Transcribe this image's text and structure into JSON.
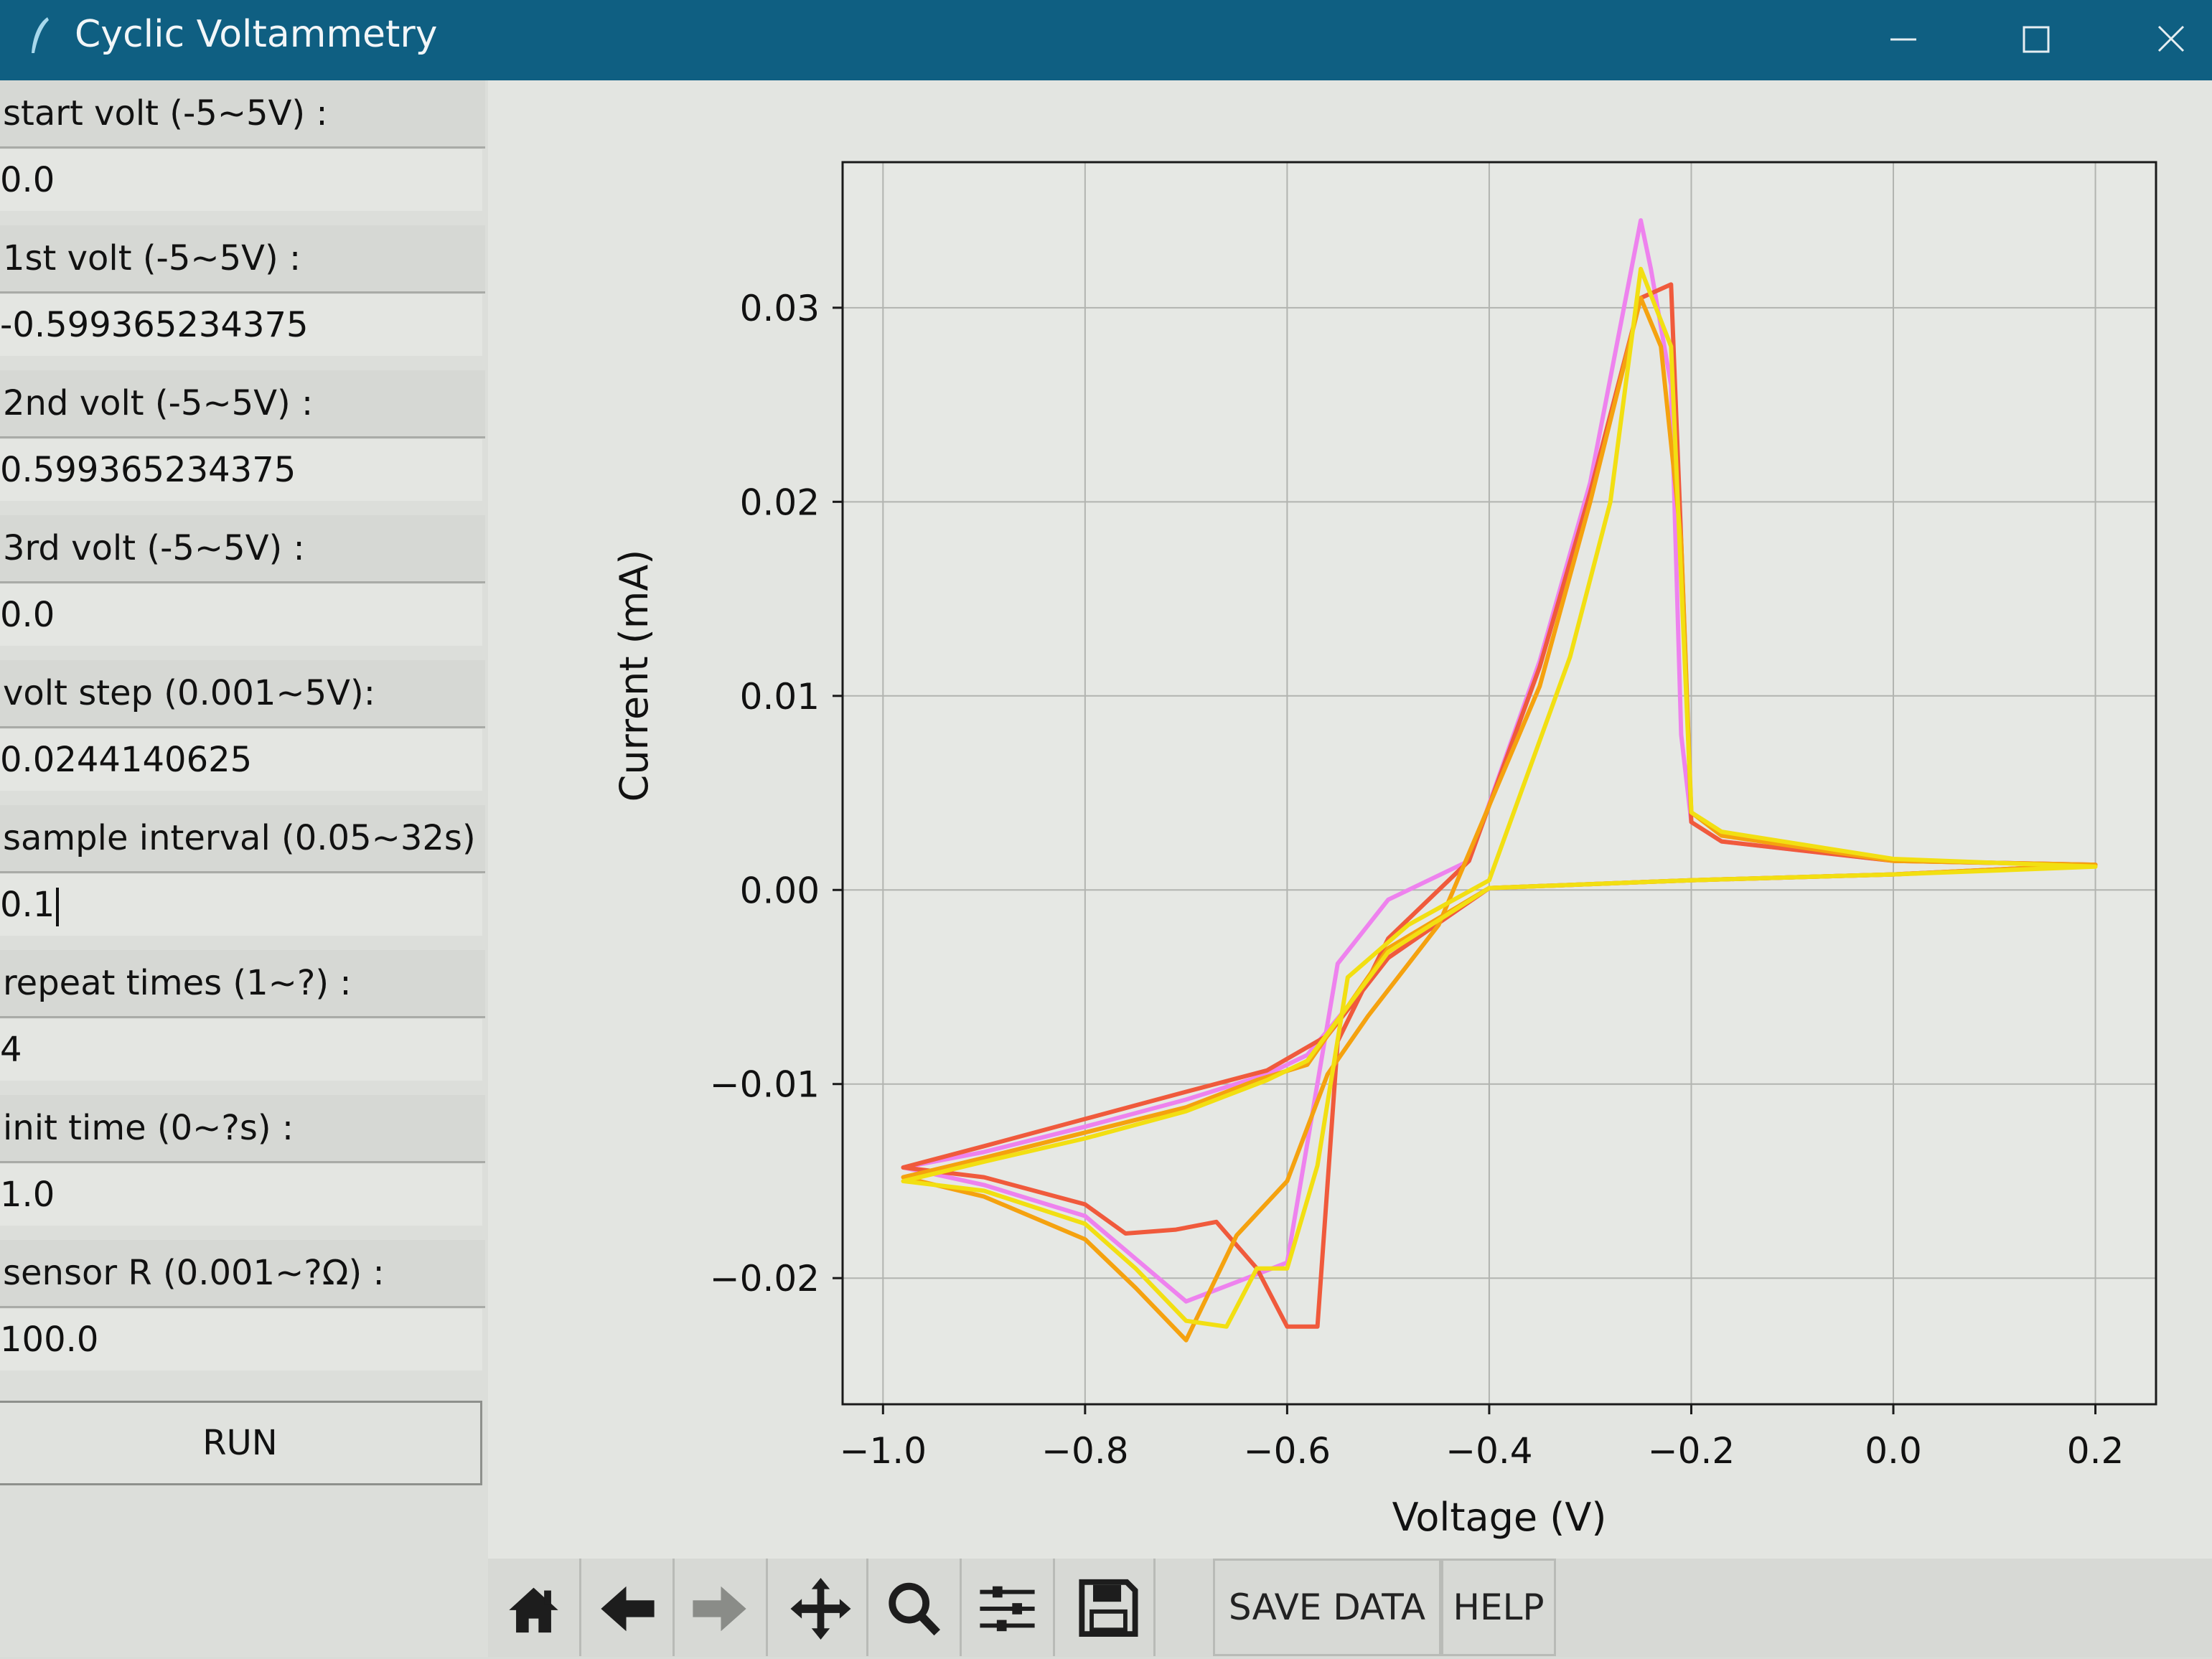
{
  "window": {
    "title": "Cyclic Voltammetry"
  },
  "fields": [
    {
      "label": "start volt (-5~5V) :",
      "value": "0.0"
    },
    {
      "label": "1st volt (-5~5V) :",
      "value": "-0.599365234375"
    },
    {
      "label": "2nd volt (-5~5V) :",
      "value": "0.599365234375"
    },
    {
      "label": "3rd volt (-5~5V) :",
      "value": "0.0"
    },
    {
      "label": "volt step (0.001~5V):",
      "value": "0.0244140625"
    },
    {
      "label": "sample interval (0.05~32s) :",
      "value": "0.1"
    },
    {
      "label": "repeat times (1~?) :",
      "value": "4"
    },
    {
      "label": "init time (0~?s) :",
      "value": "1.0"
    },
    {
      "label": "sensor R (0.001~?Ω) :",
      "value": "100.0"
    }
  ],
  "run_label": "RUN",
  "toolbar": {
    "icons": [
      "home-icon",
      "back-arrow-icon",
      "forward-arrow-icon",
      "pan-icon",
      "zoom-icon",
      "configure-subplots-icon",
      "save-icon"
    ],
    "save_data_label": "SAVE DATA",
    "help_label": "HELP"
  },
  "chart_data": {
    "type": "line",
    "title": "",
    "xlabel": "Voltage (V)",
    "ylabel": "Current (mA)",
    "xlim": [
      -1.04,
      0.26
    ],
    "ylim": [
      -0.0265,
      0.0375
    ],
    "xticks": [
      -1.0,
      -0.8,
      -0.6,
      -0.4,
      -0.2,
      0.0,
      0.2
    ],
    "xtick_labels": [
      "−1.0",
      "−0.8",
      "−0.6",
      "−0.4",
      "−0.2",
      "0.0",
      "0.2"
    ],
    "yticks": [
      -0.02,
      -0.01,
      0.0,
      0.01,
      0.02,
      0.03
    ],
    "ytick_labels": [
      "−0.02",
      "−0.01",
      "0.00",
      "0.01",
      "0.02",
      "0.03"
    ],
    "grid": true,
    "series": [
      {
        "color": "#ee82ee",
        "x": [
          0.2,
          0.0,
          -0.2,
          -0.4,
          -0.5,
          -0.58,
          -0.62,
          -0.7,
          -0.8,
          -0.9,
          -0.98,
          -0.9,
          -0.8,
          -0.7,
          -0.6,
          -0.55,
          -0.5,
          -0.42,
          -0.35,
          -0.3,
          -0.25,
          -0.24,
          -0.22,
          -0.21,
          -0.2,
          -0.17,
          0.0,
          0.2
        ],
        "y": [
          0.0013,
          0.0008,
          0.0005,
          0.0001,
          -0.0035,
          -0.0085,
          -0.0095,
          -0.0108,
          -0.0122,
          -0.0135,
          -0.0143,
          -0.0152,
          -0.0168,
          -0.0212,
          -0.0192,
          -0.0038,
          -0.0005,
          0.0015,
          0.0118,
          0.021,
          0.0345,
          0.032,
          0.026,
          0.008,
          0.0035,
          0.0025,
          0.0015,
          0.0013
        ]
      },
      {
        "color": "#f05a3c",
        "x": [
          0.2,
          0.0,
          -0.2,
          -0.4,
          -0.5,
          -0.56,
          -0.62,
          -0.7,
          -0.8,
          -0.9,
          -0.98,
          -0.9,
          -0.8,
          -0.76,
          -0.71,
          -0.67,
          -0.63,
          -0.6,
          -0.57,
          -0.55,
          -0.5,
          -0.42,
          -0.35,
          -0.3,
          -0.25,
          -0.22,
          -0.21,
          -0.2,
          -0.17,
          0.0,
          0.2
        ],
        "y": [
          0.0013,
          0.0008,
          0.0005,
          0.0001,
          -0.0035,
          -0.0075,
          -0.0093,
          -0.0104,
          -0.0118,
          -0.0132,
          -0.0143,
          -0.0148,
          -0.0162,
          -0.0177,
          -0.0175,
          -0.0171,
          -0.0195,
          -0.0225,
          -0.0225,
          -0.0078,
          -0.0025,
          0.0015,
          0.0115,
          0.0205,
          0.0305,
          0.0312,
          0.018,
          0.0035,
          0.0025,
          0.0015,
          0.0013
        ]
      },
      {
        "color": "#f5a20f",
        "x": [
          0.2,
          0.0,
          -0.2,
          -0.4,
          -0.5,
          -0.58,
          -0.63,
          -0.7,
          -0.8,
          -0.9,
          -0.98,
          -0.9,
          -0.8,
          -0.75,
          -0.7,
          -0.65,
          -0.6,
          -0.56,
          -0.52,
          -0.45,
          -0.35,
          -0.3,
          -0.25,
          -0.23,
          -0.21,
          -0.2,
          -0.17,
          0.0,
          0.2
        ],
        "y": [
          0.0013,
          0.0008,
          0.0005,
          0.0001,
          -0.003,
          -0.009,
          -0.0098,
          -0.0112,
          -0.0125,
          -0.0138,
          -0.0148,
          -0.0158,
          -0.018,
          -0.0205,
          -0.0232,
          -0.0178,
          -0.015,
          -0.0095,
          -0.0065,
          -0.0018,
          0.0105,
          0.02,
          0.0305,
          0.028,
          0.018,
          0.004,
          0.0028,
          0.0015,
          0.0013
        ]
      },
      {
        "color": "#f2df12",
        "x": [
          0.2,
          0.0,
          -0.2,
          -0.4,
          -0.5,
          -0.58,
          -0.62,
          -0.7,
          -0.8,
          -0.9,
          -0.98,
          -0.9,
          -0.8,
          -0.75,
          -0.7,
          -0.66,
          -0.63,
          -0.6,
          -0.57,
          -0.54,
          -0.48,
          -0.4,
          -0.32,
          -0.28,
          -0.25,
          -0.22,
          -0.2,
          -0.17,
          0.0,
          0.2
        ],
        "y": [
          0.0012,
          0.0008,
          0.0005,
          0.0001,
          -0.0032,
          -0.0088,
          -0.0098,
          -0.0114,
          -0.0128,
          -0.014,
          -0.015,
          -0.0155,
          -0.0172,
          -0.0195,
          -0.0222,
          -0.0225,
          -0.0195,
          -0.0195,
          -0.0142,
          -0.0045,
          -0.0018,
          0.0005,
          0.012,
          0.02,
          0.032,
          0.028,
          0.004,
          0.003,
          0.0016,
          0.0012
        ]
      }
    ]
  }
}
